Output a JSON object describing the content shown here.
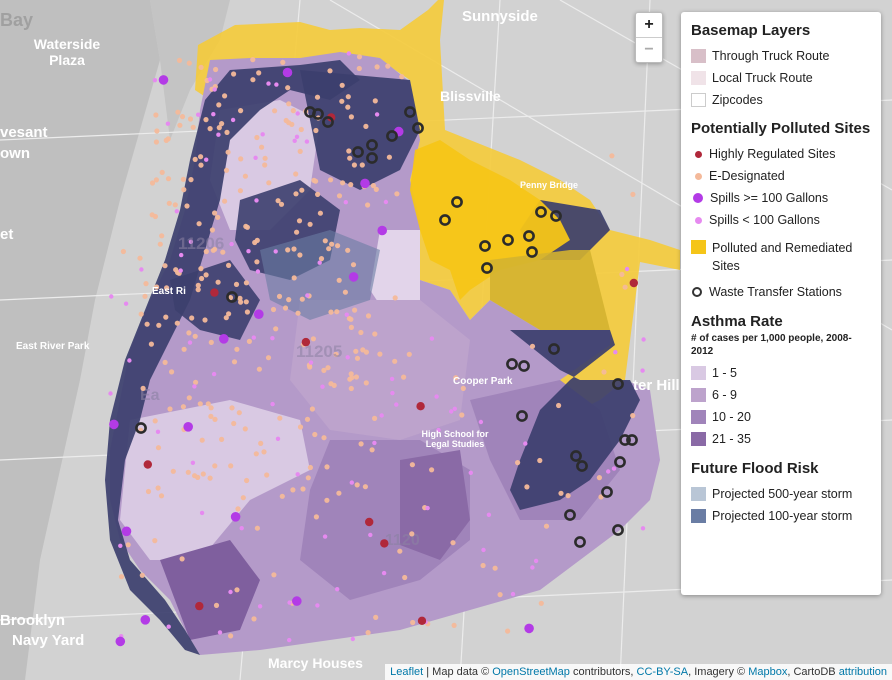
{
  "basemap_labels": [
    "Bay",
    "Waterside Plaza",
    "vesant",
    "own",
    "et",
    "East Ri",
    "East River Park",
    "Brooklyn",
    "Navy Yard",
    "Marcy Houses",
    "Sunnyside",
    "Blissville",
    "Penny Bridge",
    "Cooper Park",
    "High School for Legal Studies",
    "ter Hill",
    "11206",
    "11205",
    "Ea",
    "1120"
  ],
  "zoom": {
    "in": "+",
    "out": "−"
  },
  "legend": {
    "basemap_title": "Basemap Layers",
    "basemap_items": [
      {
        "label": "Through Truck Route",
        "color": "#d8bfc8"
      },
      {
        "label": "Local Truck Route",
        "color": "#f0e3e8"
      },
      {
        "label": "Zipcodes",
        "color": "#ffffff"
      }
    ],
    "polluted_title": "Potentially Polluted Sites",
    "polluted_items": [
      {
        "label": "Highly Regulated Sites",
        "color": "#b0283a"
      },
      {
        "label": "E-Designated",
        "color": "#f4b99a"
      },
      {
        "label": "Spills >= 100 Gallons",
        "color": "#b33be6"
      },
      {
        "label": "Spills < 100 Gallons",
        "color": "#e68af0"
      }
    ],
    "remediated_label": "Polluted and Remediated Sites",
    "remediated_color": "#f5c518",
    "waste_label": "Waste Transfer Stations",
    "asthma_title": "Asthma Rate",
    "asthma_subtitle": "# of cases per 1,000 people, 2008-2012",
    "asthma_items": [
      {
        "label": "1 - 5",
        "color": "#d9c9e3"
      },
      {
        "label": "6 - 9",
        "color": "#bda3cc"
      },
      {
        "label": "10 - 20",
        "color": "#a084ba"
      },
      {
        "label": "21 - 35",
        "color": "#8a6aa6"
      }
    ],
    "flood_title": "Future Flood Risk",
    "flood_items": [
      {
        "label": "Projected 500-year storm",
        "color": "#b9c6d6"
      },
      {
        "label": "Projected 100-year storm",
        "color": "#6a7da4"
      }
    ]
  },
  "attribution": {
    "leaflet": "Leaflet",
    "map_data": " | Map data © ",
    "osm": "OpenStreetMap",
    "contrib": " contributors, ",
    "license": "CC-BY-SA",
    "imagery": ", Imagery © ",
    "mapbox": "Mapbox",
    "carto": ", CartoDB ",
    "attribution": "attribution"
  }
}
